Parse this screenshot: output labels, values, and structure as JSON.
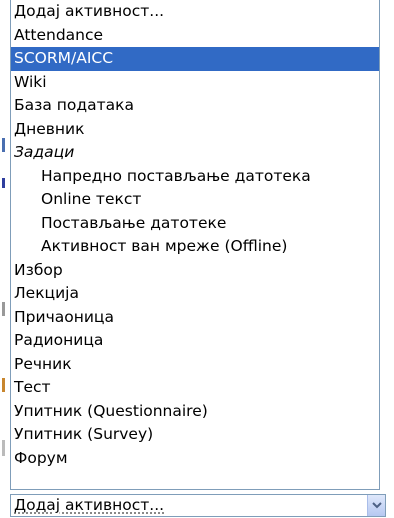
{
  "dropdown": {
    "options": [
      {
        "label": "Додај активност...",
        "kind": "plain",
        "selected": false
      },
      {
        "label": "Attendance",
        "kind": "plain",
        "selected": false
      },
      {
        "label": "SCORM/AICC",
        "kind": "plain",
        "selected": true
      },
      {
        "label": "Wiki",
        "kind": "plain",
        "selected": false
      },
      {
        "label": "База података",
        "kind": "plain",
        "selected": false
      },
      {
        "label": "Дневник",
        "kind": "plain",
        "selected": false
      },
      {
        "label": "Задаци",
        "kind": "group",
        "selected": false
      },
      {
        "label": "Напредно постављање датотека",
        "kind": "sub",
        "selected": false
      },
      {
        "label": "Online текст",
        "kind": "sub",
        "selected": false
      },
      {
        "label": "Постављање датотеке",
        "kind": "sub",
        "selected": false
      },
      {
        "label": "Активност ван мреже (Offline)",
        "kind": "sub",
        "selected": false
      },
      {
        "label": "Избор",
        "kind": "plain",
        "selected": false
      },
      {
        "label": "Лекција",
        "kind": "plain",
        "selected": false
      },
      {
        "label": "Причаоница",
        "kind": "plain",
        "selected": false
      },
      {
        "label": "Радионица",
        "kind": "plain",
        "selected": false
      },
      {
        "label": "Речник",
        "kind": "plain",
        "selected": false
      },
      {
        "label": "Тест",
        "kind": "plain",
        "selected": false
      },
      {
        "label": "Упитник (Questionnaire)",
        "kind": "plain",
        "selected": false
      },
      {
        "label": "Упитник (Survey)",
        "kind": "plain",
        "selected": false
      },
      {
        "label": "Форум",
        "kind": "plain",
        "selected": false
      }
    ]
  },
  "select": {
    "current_value": "Додај активност...",
    "button_icon": "chevron-down-icon"
  },
  "colors": {
    "highlight": "#316ac5",
    "border": "#7f9db9"
  }
}
